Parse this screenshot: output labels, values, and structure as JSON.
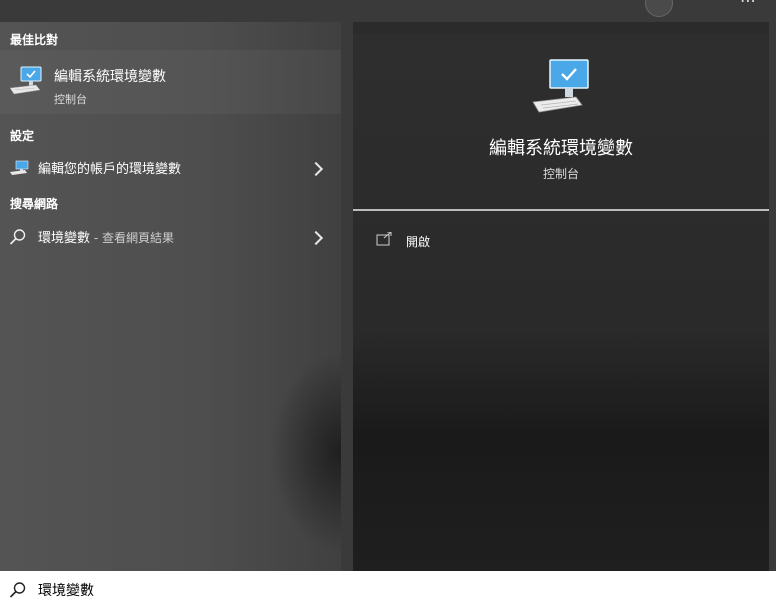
{
  "colors": {
    "left_panel": "#4f4f4f",
    "right_panel": "#2b2b2b",
    "search_bar": "#ffffff",
    "icon_blue": "#4aa8e8"
  },
  "sections": {
    "best_match_header": "最佳比對",
    "settings_header": "設定",
    "web_header": "搜尋網路"
  },
  "best_match": {
    "title": "編輯系統環境變數",
    "subtitle": "控制台",
    "icon": "control-panel-computer-icon"
  },
  "settings_result": {
    "label": "編輯您的帳戶的環境變數",
    "icon": "settings-computer-icon"
  },
  "web_result": {
    "query": "環境變數",
    "suffix": " - 查看網頁結果",
    "icon": "search-icon"
  },
  "preview": {
    "title": "編輯系統環境變數",
    "subtitle": "控制台",
    "actions": [
      {
        "label": "開啟",
        "icon": "open-icon"
      }
    ]
  },
  "search": {
    "value": "環境變數",
    "icon": "search-icon"
  }
}
